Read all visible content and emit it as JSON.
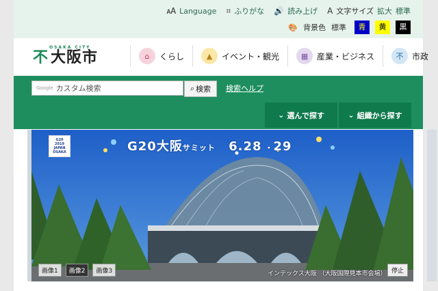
{
  "utility": {
    "language": "Language",
    "furigana": "ふりがな",
    "read_aloud": "読み上げ",
    "text_size_label": "文字サイズ",
    "text_size_large": "拡大",
    "text_size_standard": "標準",
    "bg_color_label": "背景色",
    "bg_standard": "標準",
    "bg_blue": "青",
    "bg_yellow": "黄",
    "bg_black": "黒"
  },
  "header": {
    "logo_sub": "OSAKA CITY",
    "logo_main": "大阪市",
    "nav": [
      {
        "label": "くらし",
        "icon": "house-icon"
      },
      {
        "label": "イベント・観光",
        "icon": "castle-icon"
      },
      {
        "label": "産業・ビジネス",
        "icon": "building-icon"
      },
      {
        "label": "市政",
        "icon": "city-emblem-icon"
      }
    ]
  },
  "search": {
    "brand": "Google",
    "placeholder": "カスタム検索",
    "button": "検索",
    "help": "検索ヘルプ"
  },
  "tabs": {
    "choose": "選んで探す",
    "org": "組織から探す"
  },
  "hero": {
    "logo_lines": [
      "G20",
      "2019",
      "JAPAN",
      "OSAKA"
    ],
    "banner_main": "G20大阪",
    "banner_small": "サミット",
    "banner_dates": "6.28",
    "banner_dates2": "29",
    "thumbs": [
      "画像1",
      "画像2",
      "画像3"
    ],
    "caption": "インテックス大阪 （大阪国際見本市会場）",
    "stop": "停止"
  },
  "colors": {
    "brand_green": "#1e8e5e",
    "util_bg": "#e6f3ec",
    "sky": "#2d6fd0"
  }
}
